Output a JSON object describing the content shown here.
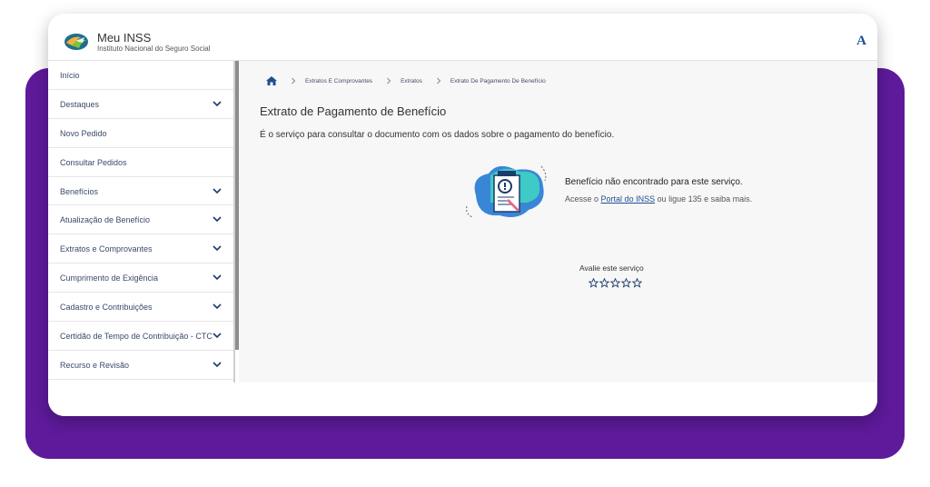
{
  "header": {
    "title": "Meu INSS",
    "subtitle": "Instituto Nacional do Seguro Social",
    "font_toggle": "A"
  },
  "sidebar": {
    "items": [
      {
        "label": "Início",
        "expandable": false
      },
      {
        "label": "Destaques",
        "expandable": true
      },
      {
        "label": "Novo Pedido",
        "expandable": false
      },
      {
        "label": "Consultar Pedidos",
        "expandable": false
      },
      {
        "label": "Benefícios",
        "expandable": true
      },
      {
        "label": "Atualização de Benefício",
        "expandable": true
      },
      {
        "label": "Extratos e Comprovantes",
        "expandable": true
      },
      {
        "label": "Cumprimento de Exigência",
        "expandable": true
      },
      {
        "label": "Cadastro e Contribuições",
        "expandable": true
      },
      {
        "label": "Certidão de Tempo de Contribuição - CTC",
        "expandable": true
      },
      {
        "label": "Recurso e Revisão",
        "expandable": true
      }
    ]
  },
  "breadcrumb": {
    "items": [
      "Extratos E Comprovantes",
      "Extratos",
      "Extrato De Pagamento De Benefício"
    ]
  },
  "main": {
    "title": "Extrato de Pagamento de Benefício",
    "description": "É o serviço para consultar o documento com os dados sobre o pagamento do benefício.",
    "not_found": {
      "title": "Benefício não encontrado para este serviço.",
      "prefix": "Acesse o",
      "link": "Portal do INSS",
      "suffix": "ou ligue 135 e saiba mais."
    },
    "rating": {
      "label": "Avalie este serviço",
      "stars": 5
    }
  },
  "colors": {
    "purple_background": "#5e1a9b",
    "accent": "#1d4f91"
  }
}
